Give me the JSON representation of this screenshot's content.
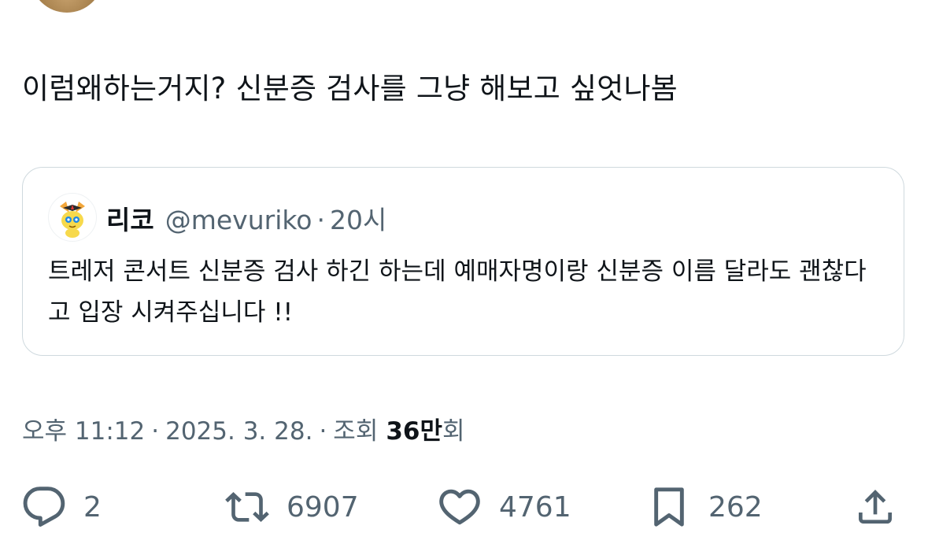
{
  "tweet": {
    "text": "이럼왜하는거지? 신분증 검사를 그냥 해보고 싶엇나봄"
  },
  "quote": {
    "name": "리코",
    "handle": "@mevuriko",
    "dot": "·",
    "time": "20시",
    "body": "트레저 콘서트 신분증 검사 하긴 하는데 예매자명이랑 신분증 이름 달라도 괜찮다고 입장 시켜주십니다 !!"
  },
  "meta": {
    "time": "오후 11:12",
    "sep1": "·",
    "date": "2025. 3. 28.",
    "sep2": "·",
    "views_label": "조회",
    "views_num": "36만",
    "views_suffix": "회"
  },
  "actions": {
    "reply_count": "2",
    "retweet_count": "6907",
    "like_count": "4761",
    "bookmark_count": "262",
    "reply_icon": "reply-icon",
    "retweet_icon": "retweet-icon",
    "like_icon": "heart-icon",
    "bookmark_icon": "bookmark-icon",
    "share_icon": "share-icon"
  },
  "colors": {
    "text": "#0f1419",
    "muted": "#536471",
    "border": "#cfd9de"
  }
}
